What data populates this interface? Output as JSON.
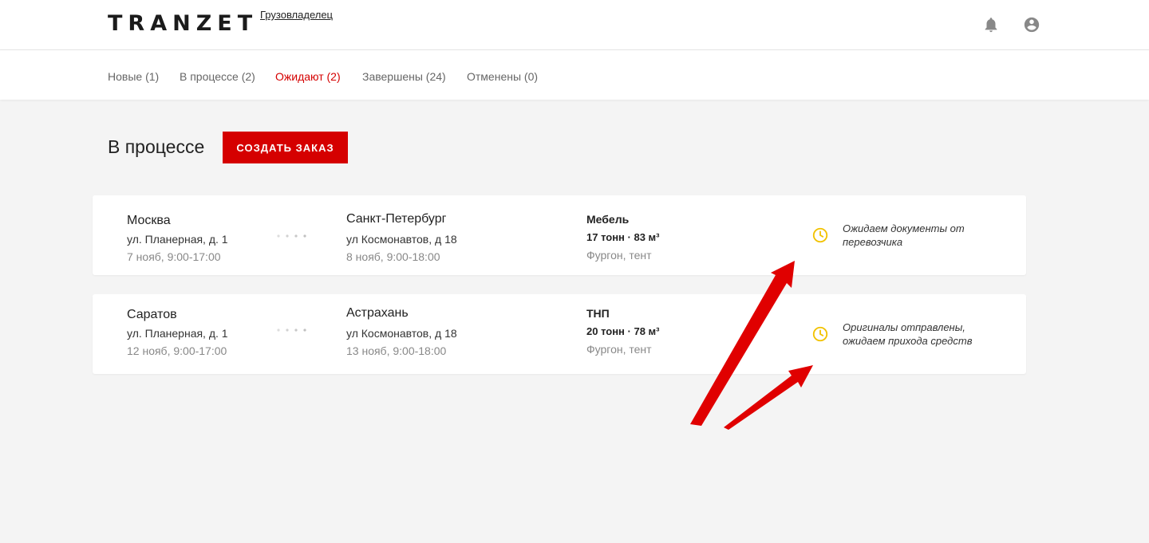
{
  "header": {
    "logo": "TRANZET",
    "role": "Грузовладелец"
  },
  "tabs": [
    {
      "label": "Новые (1)",
      "active": false
    },
    {
      "label": "В процессе (2)",
      "active": false
    },
    {
      "label": "Ожидают (2)",
      "active": true
    },
    {
      "label": "Завершены (24)",
      "active": false
    },
    {
      "label": "Отменены (0)",
      "active": false
    }
  ],
  "page": {
    "title": "В процессе",
    "create_button": "СОЗДАТЬ ЗАКАЗ"
  },
  "orders": [
    {
      "from": {
        "city": "Москва",
        "address": "ул. Планерная, д. 1",
        "date": "7 нояб, 9:00-17:00"
      },
      "to": {
        "city": "Санкт-Петербург",
        "address": "ул Космонавтов, д 18",
        "date": "8 нояб, 9:00-18:00"
      },
      "cargo": {
        "name": "Мебель",
        "weight": "17 тонн · 83 м³",
        "vehicle": "Фургон, тент"
      },
      "status": "Ожидаем документы от перевозчика"
    },
    {
      "from": {
        "city": "Саратов",
        "address": "ул. Планерная, д. 1",
        "date": "12 нояб, 9:00-17:00"
      },
      "to": {
        "city": "Астрахань",
        "address": "ул Космонавтов, д 18",
        "date": "13 нояб, 9:00-18:00"
      },
      "cargo": {
        "name": "ТНП",
        "weight": "20 тонн · 78 м³",
        "vehicle": "Фургон, тент"
      },
      "status": "Оригиналы отправлены, ожидаем прихода средств"
    }
  ],
  "colors": {
    "accent": "#d50000",
    "status_icon": "#f2c200",
    "annotation_arrow": "#e00000"
  },
  "icons": {
    "notifications": "bell-icon",
    "account": "user-icon",
    "status": "clock-icon"
  }
}
